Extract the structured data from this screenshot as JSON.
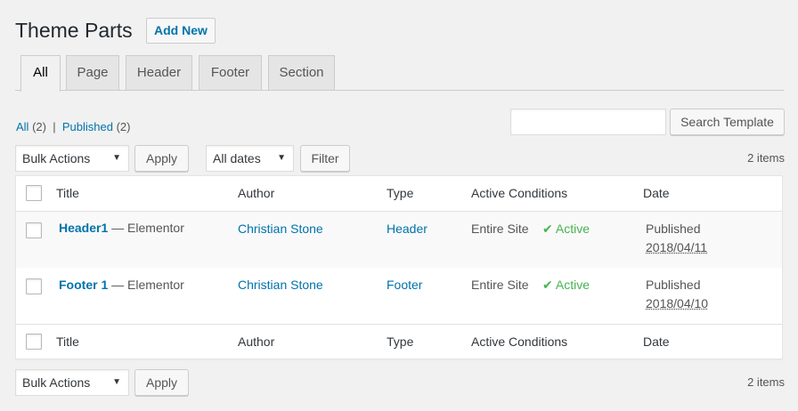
{
  "header": {
    "title": "Theme Parts",
    "add_new_label": "Add New"
  },
  "tabs": [
    {
      "label": "All",
      "active": true
    },
    {
      "label": "Page"
    },
    {
      "label": "Header"
    },
    {
      "label": "Footer"
    },
    {
      "label": "Section"
    }
  ],
  "views": {
    "all_label": "All",
    "all_count": "(2)",
    "separator": "|",
    "published_label": "Published",
    "published_count": "(2)"
  },
  "search": {
    "value": "",
    "button_label": "Search Template"
  },
  "top_nav": {
    "bulk_actions_value": "Bulk Actions",
    "apply_label": "Apply",
    "dates_value": "All dates",
    "filter_label": "Filter",
    "items_count": "2 items"
  },
  "bottom_nav": {
    "bulk_actions_value": "Bulk Actions",
    "apply_label": "Apply",
    "items_count": "2 items"
  },
  "columns": {
    "title": "Title",
    "author": "Author",
    "type": "Type",
    "conditions": "Active Conditions",
    "date": "Date"
  },
  "rows": [
    {
      "title": "Header1",
      "suffix": "— Elementor",
      "author": "Christian Stone",
      "type": "Header",
      "condition": "Entire Site",
      "active_label": "Active",
      "date_status": "Published",
      "date": "2018/04/11"
    },
    {
      "title": "Footer 1",
      "suffix": "— Elementor",
      "author": "Christian Stone",
      "type": "Footer",
      "condition": "Entire Site",
      "active_label": "Active",
      "date_status": "Published",
      "date": "2018/04/10"
    }
  ],
  "icons": {
    "check": "checkmark-icon",
    "caret": "caret-down-icon"
  },
  "colors": {
    "link": "#0073aa",
    "active": "#46b450",
    "background": "#f1f1f1"
  }
}
